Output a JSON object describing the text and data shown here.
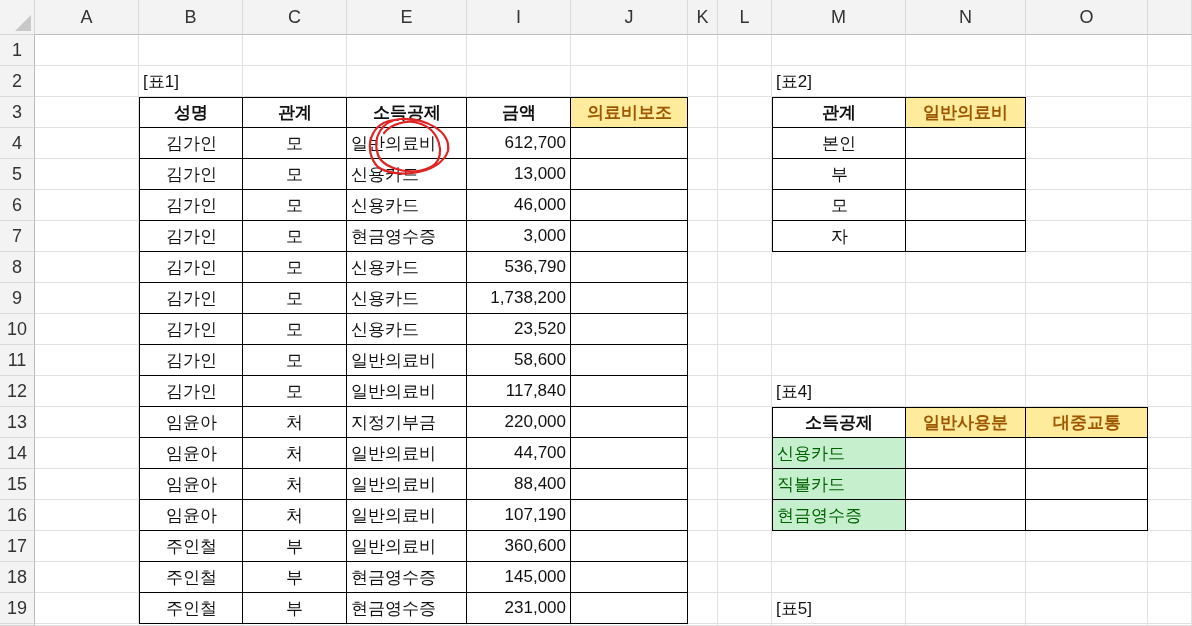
{
  "column_headers": [
    "A",
    "B",
    "C",
    "E",
    "I",
    "J",
    "K",
    "L",
    "M",
    "N",
    "O"
  ],
  "row_headers": [
    "1",
    "2",
    "3",
    "4",
    "5",
    "6",
    "7",
    "8",
    "9",
    "10",
    "11",
    "12",
    "13",
    "14",
    "15",
    "16",
    "17",
    "18",
    "19"
  ],
  "table1": {
    "caption": "[표1]",
    "columns": [
      {
        "label": "성명",
        "kind": "plain"
      },
      {
        "label": "관계",
        "kind": "plain"
      },
      {
        "label": "소득공제",
        "kind": "plain"
      },
      {
        "label": "금액",
        "kind": "plain"
      },
      {
        "label": "의료비보조",
        "kind": "highlight"
      }
    ],
    "rows": [
      [
        "김가인",
        "모",
        "일반의료비",
        "612,700",
        ""
      ],
      [
        "김가인",
        "모",
        "신용카드",
        "13,000",
        ""
      ],
      [
        "김가인",
        "모",
        "신용카드",
        "46,000",
        ""
      ],
      [
        "김가인",
        "모",
        "현금영수증",
        "3,000",
        ""
      ],
      [
        "김가인",
        "모",
        "신용카드",
        "536,790",
        ""
      ],
      [
        "김가인",
        "모",
        "신용카드",
        "1,738,200",
        ""
      ],
      [
        "김가인",
        "모",
        "신용카드",
        "23,520",
        ""
      ],
      [
        "김가인",
        "모",
        "일반의료비",
        "58,600",
        ""
      ],
      [
        "김가인",
        "모",
        "일반의료비",
        "117,840",
        ""
      ],
      [
        "임윤아",
        "처",
        "지정기부금",
        "220,000",
        ""
      ],
      [
        "임윤아",
        "처",
        "일반의료비",
        "44,700",
        ""
      ],
      [
        "임윤아",
        "처",
        "일반의료비",
        "88,400",
        ""
      ],
      [
        "임윤아",
        "처",
        "일반의료비",
        "107,190",
        ""
      ],
      [
        "주인철",
        "부",
        "일반의료비",
        "360,600",
        ""
      ],
      [
        "주인철",
        "부",
        "현금영수증",
        "145,000",
        ""
      ],
      [
        "주인철",
        "부",
        "현금영수증",
        "231,000",
        ""
      ]
    ]
  },
  "table2": {
    "caption": "[표2]",
    "columns": [
      {
        "label": "관계",
        "kind": "plain"
      },
      {
        "label": "일반의료비",
        "kind": "highlight"
      }
    ],
    "rows": [
      [
        "본인",
        ""
      ],
      [
        "부",
        ""
      ],
      [
        "모",
        ""
      ],
      [
        "자",
        ""
      ]
    ]
  },
  "table4": {
    "caption": "[표4]",
    "columns": [
      {
        "label": "소득공제",
        "kind": "plain"
      },
      {
        "label": "일반사용분",
        "kind": "highlight"
      },
      {
        "label": "대중교통",
        "kind": "highlight"
      }
    ],
    "rows": [
      [
        "신용카드",
        "",
        ""
      ],
      [
        "직불카드",
        "",
        ""
      ],
      [
        "현금영수증",
        "",
        ""
      ]
    ]
  },
  "table5": {
    "caption": "[표5]"
  },
  "annotation": {
    "kind": "ink-circle"
  }
}
